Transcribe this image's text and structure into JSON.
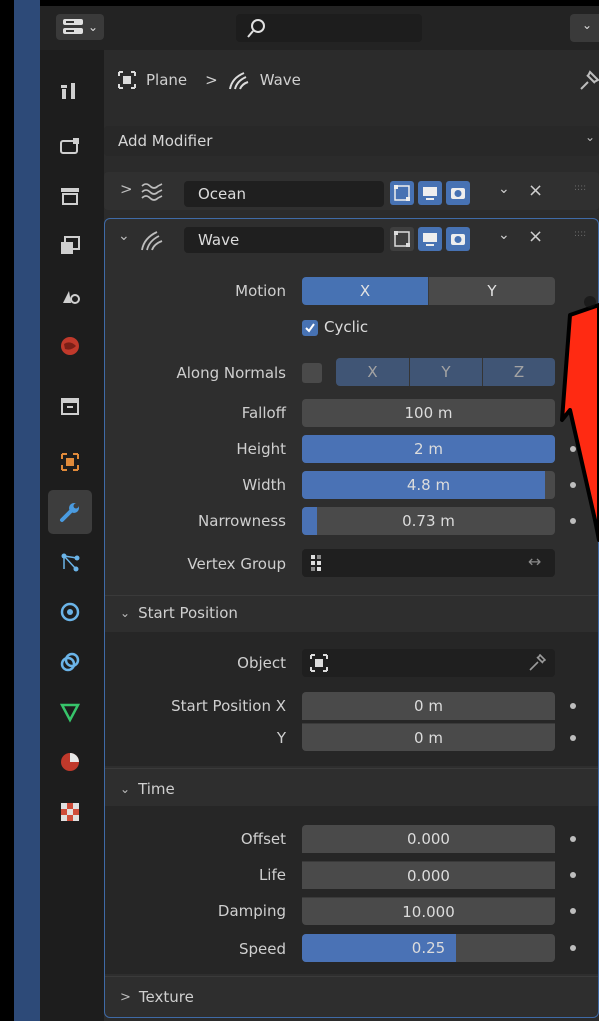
{
  "header": {
    "editor_caret": "⌄",
    "search_placeholder": ""
  },
  "breadcrumb": {
    "object": "Plane",
    "separator": ">",
    "modifier": "Wave"
  },
  "add_modifier": {
    "label": "Add Modifier"
  },
  "modifiers": {
    "ocean": {
      "name": "Ocean",
      "expand": ">"
    },
    "wave": {
      "name": "Wave",
      "expand": "⌄"
    }
  },
  "wave": {
    "motion": {
      "label": "Motion",
      "x": "X",
      "y": "Y",
      "selected": "X"
    },
    "cyclic": {
      "label": "Cyclic",
      "checked": true
    },
    "along_normals": {
      "label": "Along Normals",
      "x": "X",
      "y": "Y",
      "z": "Z"
    },
    "falloff": {
      "label": "Falloff",
      "value": "100 m",
      "fill": 0
    },
    "height": {
      "label": "Height",
      "value": "2 m",
      "fill": 1.0
    },
    "width": {
      "label": "Width",
      "value": "4.8 m",
      "fill": 0.96
    },
    "narrowness": {
      "label": "Narrowness",
      "value": "0.73 m",
      "fill": 0.06
    },
    "vertex_group": {
      "label": "Vertex Group",
      "value": ""
    },
    "start_position": {
      "heading": "Start Position",
      "object_label": "Object",
      "x_label": "Start Position X",
      "x_value": "0 m",
      "y_label": "Y",
      "y_value": "0 m"
    },
    "time": {
      "heading": "Time",
      "offset": {
        "label": "Offset",
        "value": "0.000"
      },
      "life": {
        "label": "Life",
        "value": "0.000"
      },
      "damping": {
        "label": "Damping",
        "value": "10.000"
      },
      "speed": {
        "label": "Speed",
        "value": "0.25",
        "fill": 0.61
      }
    },
    "texture": {
      "heading": "Texture"
    }
  },
  "colors": {
    "accent": "#4772b3",
    "annotation_arrow": "#ff2a12",
    "panel": "#2b2b2b"
  },
  "icons": [
    "editor-type-icon",
    "search-icon",
    "tool-icon",
    "render-icon",
    "output-icon",
    "view-layer-icon",
    "scene-icon",
    "world-icon",
    "collection-icon",
    "object-icon",
    "modifier-icon",
    "particles-icon",
    "physics-icon",
    "constraints-icon",
    "data-icon",
    "material-icon",
    "texture-icon",
    "pin-icon",
    "eyedropper-icon"
  ]
}
